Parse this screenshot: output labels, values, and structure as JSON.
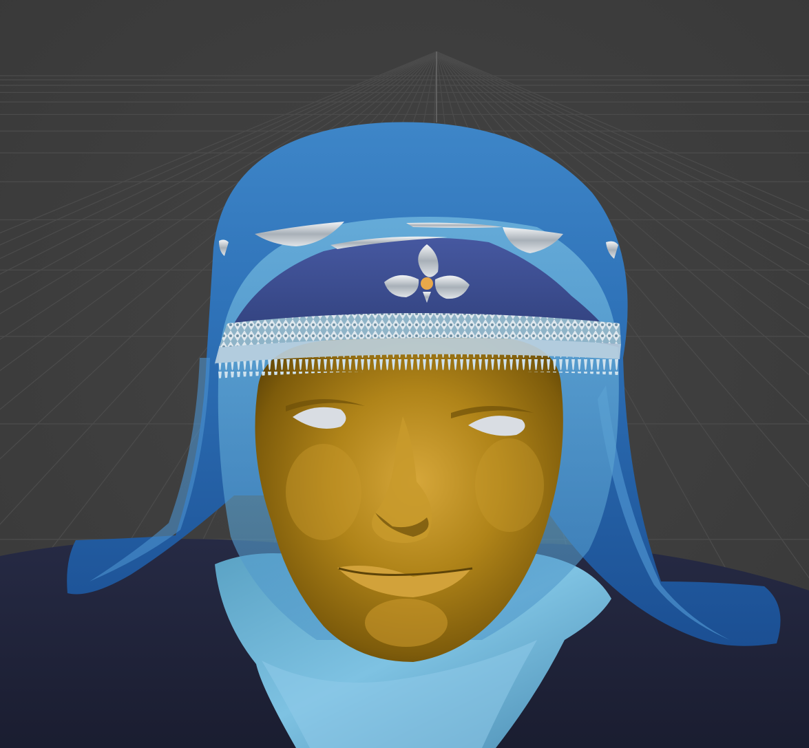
{
  "viewport": {
    "background_color": "#3d3d3d",
    "grid_line_color": "#4b4b4b",
    "grid_visible": true
  },
  "scene": {
    "objects": [
      {
        "name": "body",
        "color": "#1f2236"
      },
      {
        "name": "collar",
        "color": "#6fb6d8"
      },
      {
        "name": "face-mask",
        "color": "#a47b12"
      },
      {
        "name": "eyes",
        "color": "#d9dde3"
      },
      {
        "name": "veil",
        "color": "#1f5fa8"
      },
      {
        "name": "cap-band",
        "color": "#3a4d8e"
      },
      {
        "name": "ornament",
        "color": "#c8ccd2"
      }
    ]
  }
}
